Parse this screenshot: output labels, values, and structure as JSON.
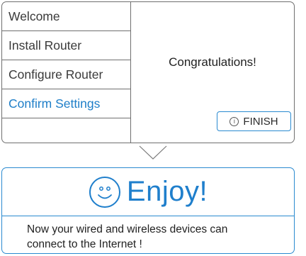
{
  "wizard": {
    "steps": [
      {
        "label": "Welcome",
        "active": false
      },
      {
        "label": "Install Router",
        "active": false
      },
      {
        "label": "Configure Router",
        "active": false
      },
      {
        "label": "Confirm Settings",
        "active": true
      }
    ],
    "congrats_text": "Congratulations!",
    "finish_button": {
      "icon": "info-circle-icon",
      "label": "FINISH"
    }
  },
  "connector": {
    "icon": "chevron-down-icon"
  },
  "enjoy": {
    "icon": "smiley-icon",
    "title": "Enjoy!",
    "message_line1": "Now your wired and wireless devices can",
    "message_line2": "connect to the Internet !"
  },
  "colors": {
    "accent": "#1e7ec8",
    "border": "#6f6f6f",
    "text": "#333333"
  }
}
